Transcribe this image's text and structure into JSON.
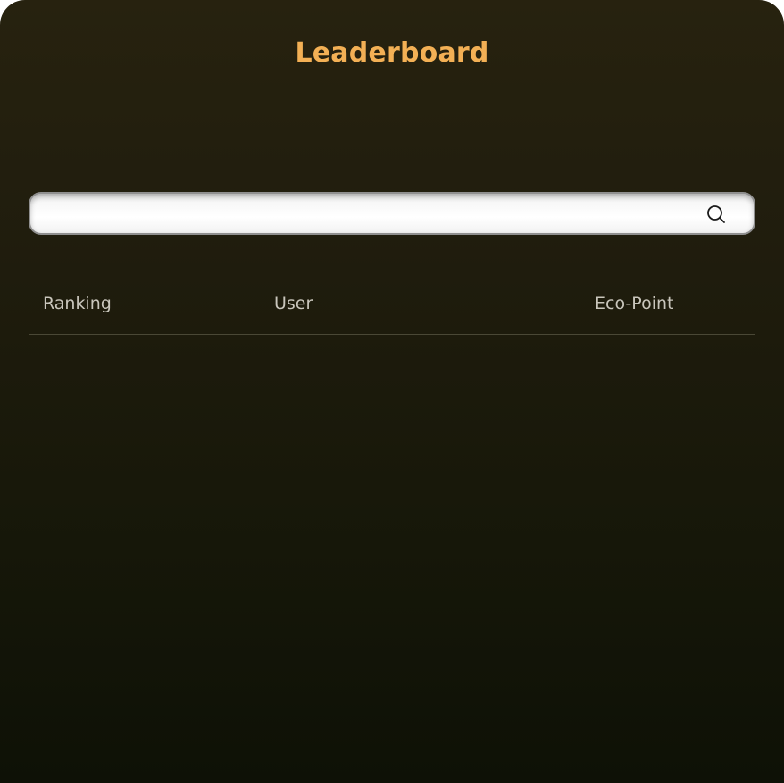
{
  "title": "Leaderboard",
  "search": {
    "value": "",
    "placeholder": "",
    "icon": "search-icon"
  },
  "table": {
    "columns": [
      "Ranking",
      "User",
      "Eco-Point"
    ],
    "rows": []
  },
  "colors": {
    "title": "#f3b055",
    "background_top": "#27220f",
    "background_bottom": "#0e1106",
    "header_text": "#c9c6bc"
  }
}
